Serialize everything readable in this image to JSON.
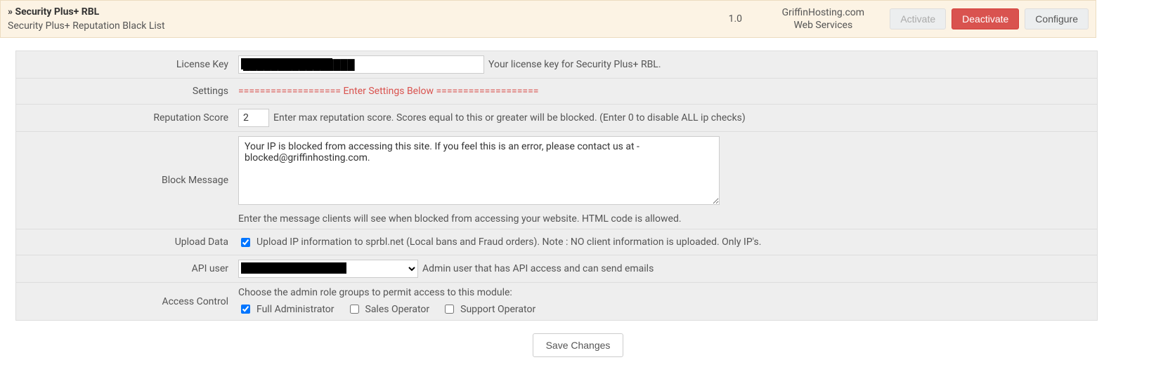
{
  "header": {
    "crumb_prefix": "» ",
    "title": "Security Plus+ RBL",
    "subtitle": "Security Plus+ Reputation Black List",
    "version": "1.0",
    "vendor_line1": "GriffinHosting.com",
    "vendor_line2": "Web Services",
    "activate": "Activate",
    "deactivate": "Deactivate",
    "configure": "Configure"
  },
  "form": {
    "license_key": {
      "label": "License Key",
      "value": "████████████████",
      "help": "Your license key for Security Plus+ RBL."
    },
    "settings_divider": {
      "label": "Settings",
      "text": "=================== Enter Settings Below ==================="
    },
    "reputation_score": {
      "label": "Reputation Score",
      "value": "2",
      "help": "Enter max reputation score. Scores equal to this or greater will be blocked. (Enter 0 to disable ALL ip checks)"
    },
    "block_message": {
      "label": "Block Message",
      "value": "Your IP is blocked from accessing this site. If you feel this is an error, please contact us at - blocked@griffinhosting.com.",
      "help": "Enter the message clients will see when blocked from accessing your website. HTML code is allowed."
    },
    "upload_data": {
      "label": "Upload Data",
      "checked": true,
      "text": "Upload IP information to sprbl.net (Local bans and Fraud orders). Note : NO client information is uploaded. Only IP's."
    },
    "api_user": {
      "label": "API user",
      "selected": "██████████",
      "help": "Admin user that has API access and can send emails"
    },
    "access_control": {
      "label": "Access Control",
      "intro": "Choose the admin role groups to permit access to this module:",
      "roles": [
        {
          "label": "Full Administrator",
          "checked": true
        },
        {
          "label": "Sales Operator",
          "checked": false
        },
        {
          "label": "Support Operator",
          "checked": false
        }
      ]
    }
  },
  "save_button": "Save Changes"
}
